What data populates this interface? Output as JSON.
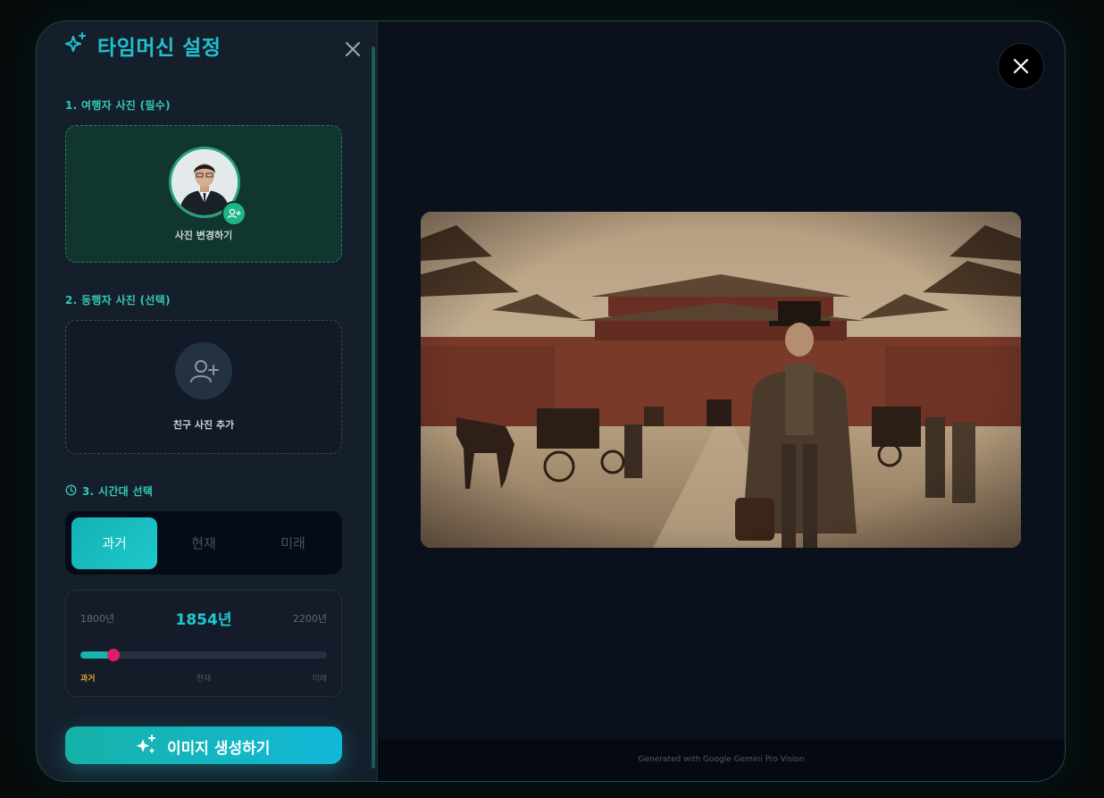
{
  "settings": {
    "title": "타임머신 설정",
    "icons": {
      "title": "sparkles-icon",
      "close": "close-icon"
    },
    "traveler": {
      "label": "1. 여행자 사진 (필수)",
      "change_label": "사진 변경하기",
      "badge_icon": "user-plus-icon"
    },
    "companion": {
      "label": "2. 동행자 사진 (선택)",
      "add_label": "친구 사진 추가",
      "icon": "user-plus-icon"
    },
    "era": {
      "label": "3. 시간대 선택",
      "icon": "clock-icon",
      "tabs": [
        {
          "label": "과거",
          "active": true
        },
        {
          "label": "현재",
          "active": false
        },
        {
          "label": "미래",
          "active": false
        }
      ]
    },
    "year": {
      "min_label": "1800년",
      "max_label": "2200년",
      "current_label": "1854년",
      "min": 1800,
      "max": 2200,
      "value": 1854,
      "ticks": [
        "과거",
        "현재",
        "미래"
      ]
    },
    "generate_label": "이미지 생성하기",
    "colors": {
      "accent": "#1fc2cf",
      "thumb": "#e01c66",
      "past_tick": "#e0a21f"
    }
  },
  "viewer": {
    "close_icon": "close-icon",
    "footer": "Generated with Google Gemini Pro Vision"
  }
}
